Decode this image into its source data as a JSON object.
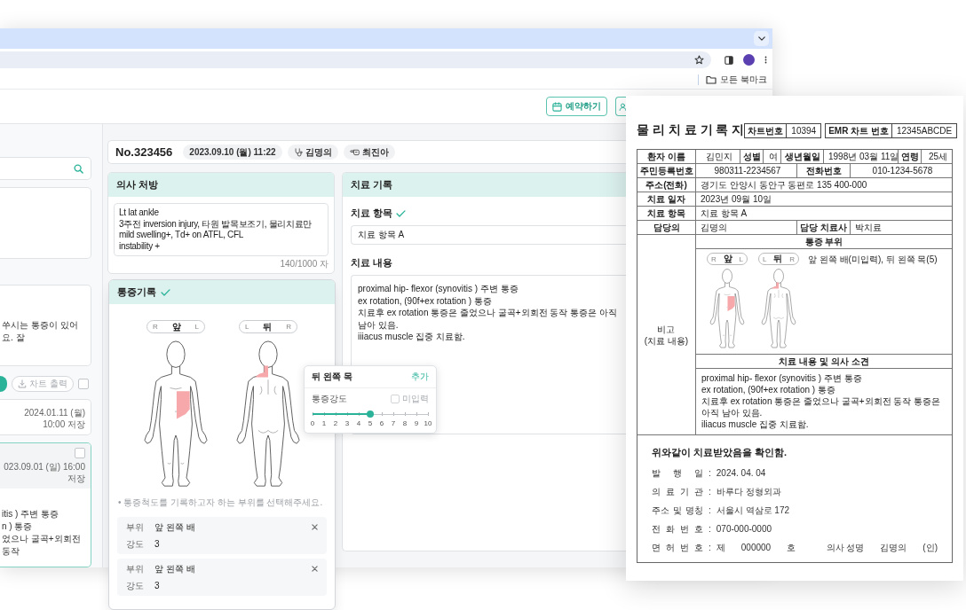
{
  "browser": {
    "bookmarks_label": "모든 북마크"
  },
  "header_buttons": [
    {
      "kind": "calendar",
      "label": "예약하기"
    },
    {
      "kind": "person"
    }
  ],
  "left_panel": {
    "note": "쑤시는 통증이 있어요. 잘",
    "actions": [
      {
        "kind": "primary"
      },
      {
        "kind": "print",
        "label": "차트 출력",
        "disabled": true
      }
    ],
    "select_all_checked": false,
    "history": [
      {
        "date": "2024.01.11 (월) 10:00 저장",
        "selected": false
      },
      {
        "date": "023.09.01 (일) 16:00 저장",
        "selected": true,
        "checked": false,
        "lines": [
          "itis ) 주변 통증",
          "n ) 통증",
          "었으나 굴곡+외회전 동작"
        ]
      }
    ]
  },
  "visit": {
    "number": "No.323456",
    "tags": [
      {
        "kind": "date",
        "text": "2023.09.10 (월) 11:22"
      },
      {
        "kind": "doctor",
        "text": "김명의"
      },
      {
        "kind": "therapist",
        "text": "최진아"
      }
    ]
  },
  "prescription": {
    "title": "의사 처방",
    "lines": [
      "Lt lat ankle",
      "3주전 inversion injury, 타원 발목보조기, 물리치료만",
      "mild swelling+, Td+ on ATFL, CFL",
      "instability +"
    ],
    "counter": "140/1000 자"
  },
  "pain_record": {
    "title": "통증기록",
    "complete": true,
    "figures": [
      {
        "kind": "front",
        "left": "R",
        "label": "앞",
        "right": "L",
        "marks": [
          {
            "kind": "abdomen-left"
          }
        ]
      },
      {
        "kind": "back",
        "left": "L",
        "label": "뒤",
        "right": "R",
        "marks": [
          {
            "kind": "neck-left"
          }
        ]
      }
    ],
    "hint": "• 통증척도를 기록하고자 하는 부위를 선택해주세요.",
    "entries": [
      {
        "site_label": "부위",
        "site": "앞 왼쪽 배",
        "intensity_label": "강도",
        "intensity": "3"
      },
      {
        "site_label": "부위",
        "site": "앞 왼쪽 배",
        "intensity_label": "강도",
        "intensity": "3"
      }
    ]
  },
  "pain_popover": {
    "title": "뒤 왼쪽 목",
    "action": "추가",
    "label": "통증강도",
    "skip": {
      "label": "미입력",
      "checked": false
    },
    "level": 0.5,
    "scale": [
      "0",
      "1",
      "2",
      "3",
      "4",
      "5",
      "6",
      "7",
      "8",
      "9",
      "10"
    ]
  },
  "treatment": {
    "title": "치료 기록",
    "item_label": "치료 항목",
    "item_complete": true,
    "item_value": "치료 항목 A",
    "content_label": "치료 내용",
    "content_lines": [
      "proximal hip- flexor (synovitis ) 주변 통증",
      "ex rotation, (90f+ex rotation ) 통증",
      "치료후 ex rotation 통증은 줄었으나 굴곡+외회전 동작 통증은 아직 남아 있음.",
      "iiiacus muscle 집중 치료함."
    ]
  },
  "document": {
    "title": "물 리 치 료 기 록 지",
    "ids": [
      {
        "label": "차트번호",
        "value": "10394"
      },
      {
        "label": "EMR 차트 번호",
        "value": "12345ABCDE"
      }
    ],
    "info_lines": [
      {
        "fields": [
          {
            "label": "환자 이름",
            "value": "김민지"
          },
          {
            "label": "성별",
            "value": "여"
          },
          {
            "label": "생년월일",
            "value": "1998년 03월 11일"
          },
          {
            "label": "연령",
            "value": "25세"
          }
        ]
      },
      {
        "fields": [
          {
            "label": "주민등록번호",
            "value": "980311-2234567"
          },
          {
            "label": "전화번호",
            "value": "010-1234-5678"
          }
        ]
      },
      {
        "fields": [
          {
            "label": "주소(전화)",
            "value": "경기도 안양시 동안구 동편로 135 400-000"
          }
        ]
      },
      {
        "fields": [
          {
            "label": "치료 일자",
            "value": "2023년 09월 10일"
          }
        ]
      },
      {
        "fields": [
          {
            "label": "치료 항목",
            "value": "치료 항목 A"
          }
        ]
      },
      {
        "fields": [
          {
            "label": "담당의",
            "value": "김명의"
          },
          {
            "label": "담당 치료사",
            "value": "박치료"
          }
        ]
      }
    ],
    "remarks_label": [
      "비고",
      "(치료 내용)"
    ],
    "pain_site": {
      "title": "통증 부위",
      "figures": [
        {
          "kind": "front",
          "left": "R",
          "label": "앞",
          "right": "L",
          "marks": [
            {
              "kind": "abdomen-left"
            }
          ]
        },
        {
          "kind": "back",
          "left": "L",
          "label": "뒤",
          "right": "R",
          "marks": [
            {
              "kind": "neck-left"
            }
          ]
        }
      ],
      "summary": "앞 왼쪽 배(미입력), 뒤 왼쪽 목(5)"
    },
    "findings": {
      "title": "치료 내용 및 의사 소견",
      "lines": [
        "proximal hip- flexor (synovitis ) 주변 통증",
        "ex rotation, (90f+ex rotation ) 통증",
        "치료후 ex rotation 통증은 줄었으나 굴곡+외회전 동작 통증은 아직 남아 있음.",
        "iliacus muscle 집중 치료함."
      ]
    },
    "confirmation": "위와같이 치료받았음을 확인함.",
    "details": [
      {
        "label": "발 행 일",
        "sep": ":",
        "value": "2024. 04. 04"
      },
      {
        "label": "의 료 기 관",
        "sep": ":",
        "value": "바루다 정형외과"
      },
      {
        "label": "주소 및 명칭",
        "sep": ":",
        "value": "서울시 역삼로 172"
      },
      {
        "label": "전 화 번 호",
        "sep": ":",
        "value": "070-000-0000"
      }
    ],
    "license": {
      "label": "면 허 번 호",
      "sep": ":",
      "parts": [
        "제",
        "000000",
        "호"
      ],
      "signer_label": "의사 성명",
      "signer": "김명의",
      "seal": "(인)"
    }
  }
}
